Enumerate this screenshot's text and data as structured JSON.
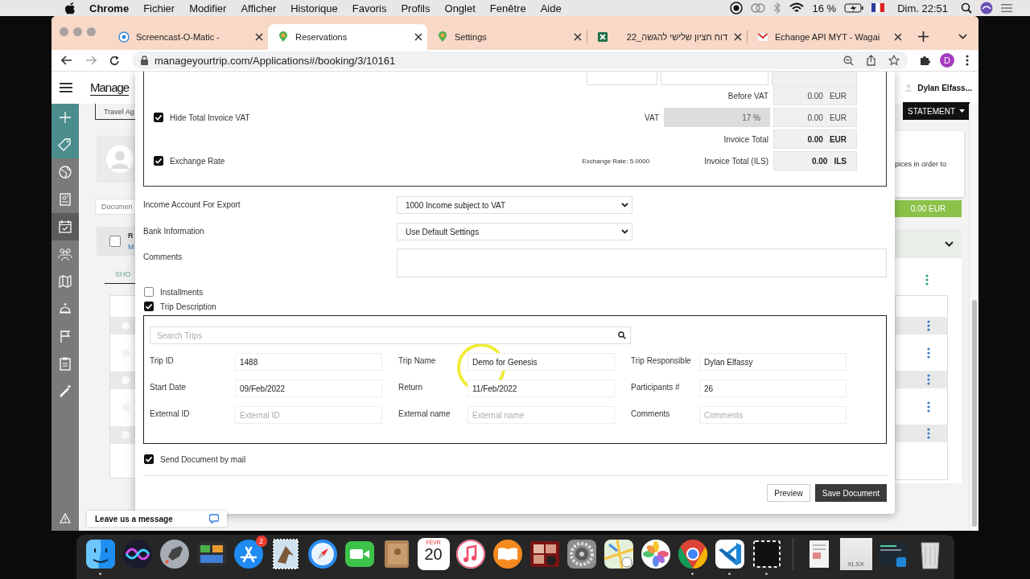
{
  "menubar": {
    "items": [
      "Chrome",
      "Fichier",
      "Modifier",
      "Afficher",
      "Historique",
      "Favoris",
      "Profils",
      "Onglet",
      "Fenêtre",
      "Aide"
    ],
    "battery": "16 %",
    "clock": "Dim. 22:51"
  },
  "browser": {
    "tabs": [
      {
        "title": "Screencast-O-Matic -",
        "kind": "record",
        "selected": false
      },
      {
        "title": "Reservations",
        "kind": "pin",
        "selected": true
      },
      {
        "title": "Settings",
        "kind": "pin",
        "selected": false
      },
      {
        "title": "דוח חציון שלישי להגשה_22",
        "kind": "sheet",
        "selected": false
      },
      {
        "title": "Echange API MYT - Wagai",
        "kind": "mail",
        "selected": false
      }
    ],
    "url": "manageyourtrip.com/Applications#/booking/3/10161",
    "profile": "D"
  },
  "app": {
    "logo": "Manage",
    "user": "Dylan Elfass...",
    "nav": [
      {
        "kind": "plus",
        "accent": true,
        "selected": false
      },
      {
        "kind": "tag",
        "accent": true,
        "selected": false
      },
      {
        "kind": "globe",
        "accent": false,
        "selected": false
      },
      {
        "kind": "card",
        "accent": false,
        "selected": false
      },
      {
        "kind": "calendar",
        "accent": false,
        "selected": true
      },
      {
        "kind": "people",
        "accent": false,
        "selected": false
      },
      {
        "kind": "map",
        "accent": false,
        "selected": false
      },
      {
        "kind": "bell",
        "accent": false,
        "selected": false
      },
      {
        "kind": "flag",
        "accent": false,
        "selected": false
      },
      {
        "kind": "clipboard",
        "accent": false,
        "selected": false
      },
      {
        "kind": "wand",
        "accent": false,
        "selected": false
      }
    ],
    "background": {
      "agency_tab": "Travel Ag",
      "document_placeholder": "Documen",
      "row_checked": false,
      "row_title": "R",
      "row_subtitle": "M",
      "show_tab": "SHO",
      "statement_button": "STATEMENT",
      "notice": "pices in order to",
      "balance": "0.00 EUR"
    }
  },
  "modal": {
    "totals": [
      {
        "label": "Before VAT",
        "amount": "0.00",
        "currency": "EUR",
        "bold": false
      },
      {
        "label": "VAT",
        "rate": "17 %",
        "amount": "0.00",
        "currency": "EUR",
        "bold": false
      },
      {
        "label": "Invoice Total",
        "amount": "0.00",
        "currency": "EUR",
        "bold": true
      },
      {
        "label": "Invoice Total (ILS)",
        "note": "Exchange Rate: 5.0000",
        "amount": "0.00",
        "currency": "ILS",
        "bold": true
      }
    ],
    "toggles": [
      {
        "label": "Hide Total Invoice VAT",
        "checked": true
      },
      {
        "label": "Exchange Rate",
        "checked": true
      }
    ],
    "settings": [
      {
        "label": "Income Account For Export",
        "kind": "select",
        "value": "1000 Income subject to VAT"
      },
      {
        "label": "Bank Information",
        "kind": "select",
        "value": "Use Default Settings"
      },
      {
        "label": "Comments",
        "kind": "textarea"
      }
    ],
    "sections": [
      {
        "label": "Installments",
        "checked": false
      },
      {
        "label": "Trip Description",
        "checked": true
      }
    ],
    "trip": {
      "search_placeholder": "Search Trips",
      "fields": [
        {
          "label": "Trip ID",
          "value": "1488"
        },
        {
          "label": "Trip Name",
          "value": "Demo for Genesis"
        },
        {
          "label": "Trip Responsible",
          "value": "Dylan Elfassy"
        },
        {
          "label": "Start Date",
          "value": "09/Feb/2022"
        },
        {
          "label": "Return",
          "value": "11/Feb/2022"
        },
        {
          "label": "Participants #",
          "value": "26"
        },
        {
          "label": "External ID",
          "placeholder": "External ID"
        },
        {
          "label": "External name",
          "placeholder": "External name"
        },
        {
          "label": "Comments",
          "placeholder": "Comments"
        }
      ]
    },
    "send_mail": {
      "label": "Send Document by mail",
      "checked": true
    },
    "buttons": [
      {
        "label": "Preview",
        "kind": "secondary"
      },
      {
        "label": "Save Document",
        "kind": "primary"
      }
    ]
  },
  "chat": {
    "label": "Leave us a message"
  },
  "dock": [
    {
      "kind": "finder",
      "running": true
    },
    {
      "kind": "siri",
      "running": false
    },
    {
      "kind": "launchpad",
      "running": false
    },
    {
      "kind": "mission",
      "running": false
    },
    {
      "kind": "store",
      "badge": "2",
      "running": false
    },
    {
      "kind": "mail",
      "running": false
    },
    {
      "kind": "safari",
      "running": false
    },
    {
      "kind": "facetime",
      "running": false
    },
    {
      "kind": "contacts",
      "running": false
    },
    {
      "kind": "calendar",
      "month": "FÉVR",
      "day": "20",
      "running": false
    },
    {
      "kind": "music",
      "running": false
    },
    {
      "kind": "books",
      "running": false
    },
    {
      "kind": "photobooth",
      "running": false
    },
    {
      "kind": "prefs",
      "running": false
    },
    {
      "kind": "maps",
      "running": false
    },
    {
      "kind": "photos",
      "running": false
    },
    {
      "kind": "chrome",
      "running": true
    },
    {
      "kind": "vscode",
      "running": true
    },
    {
      "kind": "screenshot",
      "running": true
    },
    {
      "kind": "document",
      "running": false
    },
    {
      "kind": "spreadsheet",
      "label": "XLSX",
      "running": false
    },
    {
      "kind": "window",
      "running": false
    },
    {
      "kind": "trash",
      "running": false
    }
  ]
}
